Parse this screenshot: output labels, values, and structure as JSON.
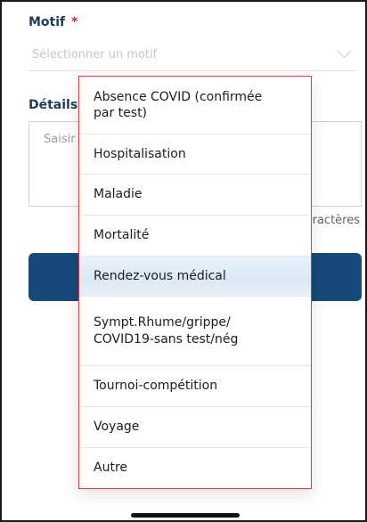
{
  "form": {
    "motif_label": "Motif",
    "required_mark": "*",
    "motif_placeholder": "Sélectionner un motif",
    "details_label": "Détails",
    "details_placeholder": "Saisir",
    "char_counter": "ractères"
  },
  "dropdown": {
    "options": [
      {
        "label": "Absence COVID (confirmée\npar test)"
      },
      {
        "label": "Hospitalisation"
      },
      {
        "label": "Maladie"
      },
      {
        "label": "Mortalité"
      },
      {
        "label": "Rendez-vous médical",
        "highlighted": true
      },
      {
        "label": "Sympt.Rhume/grippe/\nCOVID19-sans test/nég"
      },
      {
        "label": "Tournoi-compétition"
      },
      {
        "label": "Voyage"
      },
      {
        "label": "Autre"
      }
    ]
  },
  "colors": {
    "label": "#1f3b5a",
    "required": "#d4231f",
    "button": "#17497a",
    "dropdown_border": "#e0383b",
    "highlight": "#dbe8f4"
  },
  "icons": {
    "select_chevron": "chevron-down-icon"
  }
}
